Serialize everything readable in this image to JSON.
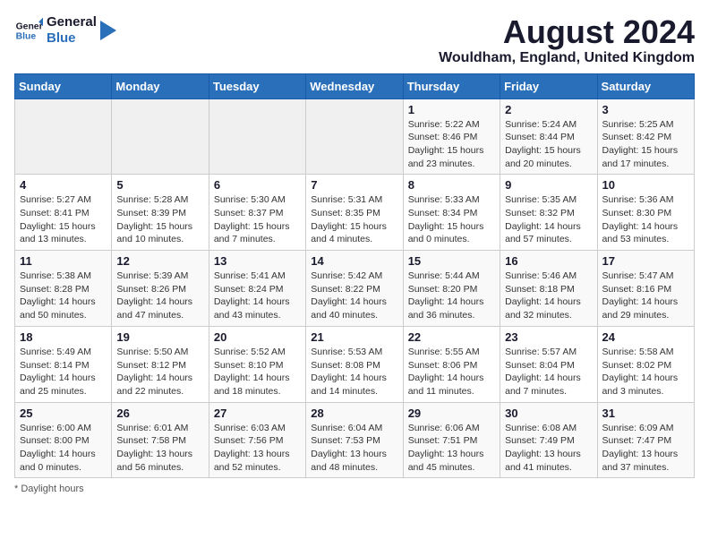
{
  "logo": {
    "line1": "General",
    "line2": "Blue"
  },
  "title": "August 2024",
  "location": "Wouldham, England, United Kingdom",
  "days_of_week": [
    "Sunday",
    "Monday",
    "Tuesday",
    "Wednesday",
    "Thursday",
    "Friday",
    "Saturday"
  ],
  "footer": "Daylight hours",
  "weeks": [
    [
      {
        "day": "",
        "sunrise": "",
        "sunset": "",
        "daylight": ""
      },
      {
        "day": "",
        "sunrise": "",
        "sunset": "",
        "daylight": ""
      },
      {
        "day": "",
        "sunrise": "",
        "sunset": "",
        "daylight": ""
      },
      {
        "day": "",
        "sunrise": "",
        "sunset": "",
        "daylight": ""
      },
      {
        "day": "1",
        "sunrise": "5:22 AM",
        "sunset": "8:46 PM",
        "daylight": "15 hours and 23 minutes."
      },
      {
        "day": "2",
        "sunrise": "5:24 AM",
        "sunset": "8:44 PM",
        "daylight": "15 hours and 20 minutes."
      },
      {
        "day": "3",
        "sunrise": "5:25 AM",
        "sunset": "8:42 PM",
        "daylight": "15 hours and 17 minutes."
      }
    ],
    [
      {
        "day": "4",
        "sunrise": "5:27 AM",
        "sunset": "8:41 PM",
        "daylight": "15 hours and 13 minutes."
      },
      {
        "day": "5",
        "sunrise": "5:28 AM",
        "sunset": "8:39 PM",
        "daylight": "15 hours and 10 minutes."
      },
      {
        "day": "6",
        "sunrise": "5:30 AM",
        "sunset": "8:37 PM",
        "daylight": "15 hours and 7 minutes."
      },
      {
        "day": "7",
        "sunrise": "5:31 AM",
        "sunset": "8:35 PM",
        "daylight": "15 hours and 4 minutes."
      },
      {
        "day": "8",
        "sunrise": "5:33 AM",
        "sunset": "8:34 PM",
        "daylight": "15 hours and 0 minutes."
      },
      {
        "day": "9",
        "sunrise": "5:35 AM",
        "sunset": "8:32 PM",
        "daylight": "14 hours and 57 minutes."
      },
      {
        "day": "10",
        "sunrise": "5:36 AM",
        "sunset": "8:30 PM",
        "daylight": "14 hours and 53 minutes."
      }
    ],
    [
      {
        "day": "11",
        "sunrise": "5:38 AM",
        "sunset": "8:28 PM",
        "daylight": "14 hours and 50 minutes."
      },
      {
        "day": "12",
        "sunrise": "5:39 AM",
        "sunset": "8:26 PM",
        "daylight": "14 hours and 47 minutes."
      },
      {
        "day": "13",
        "sunrise": "5:41 AM",
        "sunset": "8:24 PM",
        "daylight": "14 hours and 43 minutes."
      },
      {
        "day": "14",
        "sunrise": "5:42 AM",
        "sunset": "8:22 PM",
        "daylight": "14 hours and 40 minutes."
      },
      {
        "day": "15",
        "sunrise": "5:44 AM",
        "sunset": "8:20 PM",
        "daylight": "14 hours and 36 minutes."
      },
      {
        "day": "16",
        "sunrise": "5:46 AM",
        "sunset": "8:18 PM",
        "daylight": "14 hours and 32 minutes."
      },
      {
        "day": "17",
        "sunrise": "5:47 AM",
        "sunset": "8:16 PM",
        "daylight": "14 hours and 29 minutes."
      }
    ],
    [
      {
        "day": "18",
        "sunrise": "5:49 AM",
        "sunset": "8:14 PM",
        "daylight": "14 hours and 25 minutes."
      },
      {
        "day": "19",
        "sunrise": "5:50 AM",
        "sunset": "8:12 PM",
        "daylight": "14 hours and 22 minutes."
      },
      {
        "day": "20",
        "sunrise": "5:52 AM",
        "sunset": "8:10 PM",
        "daylight": "14 hours and 18 minutes."
      },
      {
        "day": "21",
        "sunrise": "5:53 AM",
        "sunset": "8:08 PM",
        "daylight": "14 hours and 14 minutes."
      },
      {
        "day": "22",
        "sunrise": "5:55 AM",
        "sunset": "8:06 PM",
        "daylight": "14 hours and 11 minutes."
      },
      {
        "day": "23",
        "sunrise": "5:57 AM",
        "sunset": "8:04 PM",
        "daylight": "14 hours and 7 minutes."
      },
      {
        "day": "24",
        "sunrise": "5:58 AM",
        "sunset": "8:02 PM",
        "daylight": "14 hours and 3 minutes."
      }
    ],
    [
      {
        "day": "25",
        "sunrise": "6:00 AM",
        "sunset": "8:00 PM",
        "daylight": "14 hours and 0 minutes."
      },
      {
        "day": "26",
        "sunrise": "6:01 AM",
        "sunset": "7:58 PM",
        "daylight": "13 hours and 56 minutes."
      },
      {
        "day": "27",
        "sunrise": "6:03 AM",
        "sunset": "7:56 PM",
        "daylight": "13 hours and 52 minutes."
      },
      {
        "day": "28",
        "sunrise": "6:04 AM",
        "sunset": "7:53 PM",
        "daylight": "13 hours and 48 minutes."
      },
      {
        "day": "29",
        "sunrise": "6:06 AM",
        "sunset": "7:51 PM",
        "daylight": "13 hours and 45 minutes."
      },
      {
        "day": "30",
        "sunrise": "6:08 AM",
        "sunset": "7:49 PM",
        "daylight": "13 hours and 41 minutes."
      },
      {
        "day": "31",
        "sunrise": "6:09 AM",
        "sunset": "7:47 PM",
        "daylight": "13 hours and 37 minutes."
      }
    ]
  ]
}
